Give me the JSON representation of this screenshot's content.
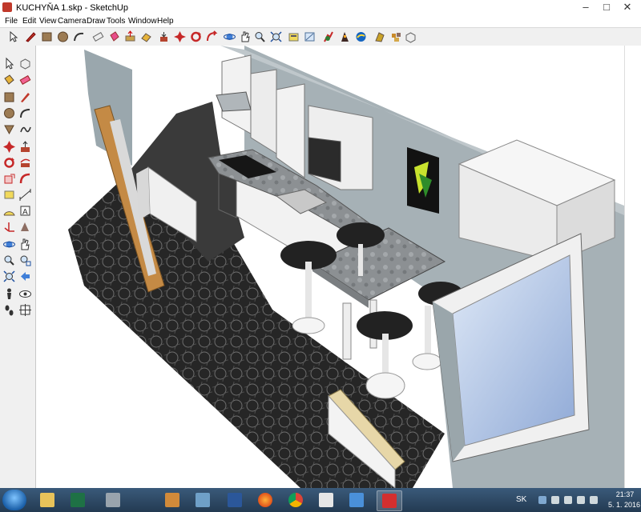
{
  "window": {
    "title": "KUCHYŇA 1.skp - SketchUp",
    "minimize": "–",
    "maximize": "□",
    "close": "✕"
  },
  "menu": [
    "File",
    "Edit",
    "View",
    "Camera",
    "Draw",
    "Tools",
    "Window",
    "Help"
  ],
  "toolbar_icons": [
    "select-icon",
    "pencil-icon",
    "rectangle-icon",
    "circle-icon",
    "arc-icon",
    "eraser-icon",
    "paint-bucket-icon",
    "push-pull-icon",
    "move-icon",
    "rotate-icon",
    "follow-me-icon",
    "scale-icon",
    "offset-icon",
    "orbit-icon",
    "pan-icon",
    "zoom-icon",
    "zoom-extents-icon",
    "tape-measure-icon",
    "dimension-icon",
    "protractor-icon",
    "text-icon",
    "axes-icon",
    "3d-text-icon",
    "get-models-icon",
    "share-model-icon",
    "components-icon",
    "extension-icon"
  ],
  "left_toolbar_icons": [
    "select-icon",
    "make-component-icon",
    "paint-bucket-icon",
    "eraser-icon",
    "rectangle-icon",
    "line-icon",
    "circle-icon",
    "arc-icon",
    "polygon-icon",
    "freehand-icon",
    "move-icon",
    "push-pull-icon",
    "rotate-icon",
    "follow-me-icon",
    "scale-icon",
    "offset-icon",
    "tape-measure-icon",
    "dimension-icon",
    "protractor-icon",
    "text-icon",
    "axes-icon",
    "3d-text-icon",
    "orbit-icon",
    "pan-icon",
    "zoom-icon",
    "zoom-window-icon",
    "zoom-extents-icon",
    "previous-view-icon",
    "position-camera-icon",
    "look-around-icon",
    "walk-icon",
    "section-plane-icon"
  ],
  "taskbar": {
    "apps": [
      "explorer-icon",
      "excel-icon",
      "media-icon",
      "word-icon",
      "firefox-icon",
      "chrome-icon",
      "calculator-icon",
      "photos-icon",
      "sketchup-icon"
    ],
    "language": "SK",
    "time": "21:37",
    "date": "5. 1. 2016"
  },
  "colors": {
    "wall": "#a9b4b9",
    "floor": "#2c2c2c",
    "countertop": "#8f9396",
    "cabinet": "#f2f2f2",
    "door_frame": "#c48a45",
    "taskbar": "#2f4b68"
  }
}
